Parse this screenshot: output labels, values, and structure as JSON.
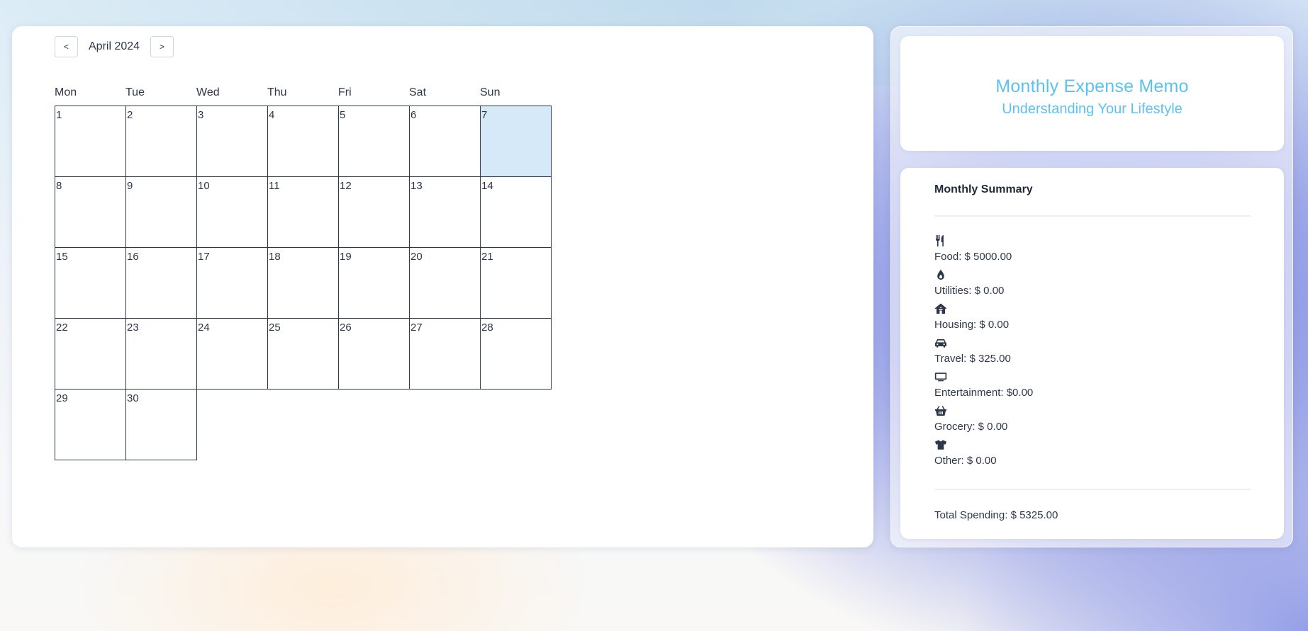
{
  "calendar": {
    "prev_label": "<",
    "next_label": ">",
    "month_label": "April 2024",
    "weekdays": [
      "Mon",
      "Tue",
      "Wed",
      "Thu",
      "Fri",
      "Sat",
      "Sun"
    ],
    "days": [
      "1",
      "2",
      "3",
      "4",
      "5",
      "6",
      "7",
      "8",
      "9",
      "10",
      "11",
      "12",
      "13",
      "14",
      "15",
      "16",
      "17",
      "18",
      "19",
      "20",
      "21",
      "22",
      "23",
      "24",
      "25",
      "26",
      "27",
      "28",
      "29",
      "30"
    ],
    "highlighted_day": "7",
    "highlight_color": "#d5e9f8"
  },
  "header_card": {
    "title": "Monthly Expense Memo",
    "subtitle": "Understanding Your Lifestyle",
    "accent_color": "#5bc2ee"
  },
  "summary": {
    "title": "Monthly Summary",
    "items": [
      {
        "icon": "utensils-icon",
        "text": "Food: $ 5000.00"
      },
      {
        "icon": "drop-icon",
        "text": "Utilities: $ 0.00"
      },
      {
        "icon": "house-icon",
        "text": "Housing: $ 0.00"
      },
      {
        "icon": "car-icon",
        "text": "Travel: $ 325.00"
      },
      {
        "icon": "tv-icon",
        "text": "Entertainment: $0.00"
      },
      {
        "icon": "basket-icon",
        "text": "Grocery: $ 0.00"
      },
      {
        "icon": "shirt-icon",
        "text": "Other: $ 0.00"
      }
    ],
    "total": "Total Spending: $ 5325.00"
  }
}
